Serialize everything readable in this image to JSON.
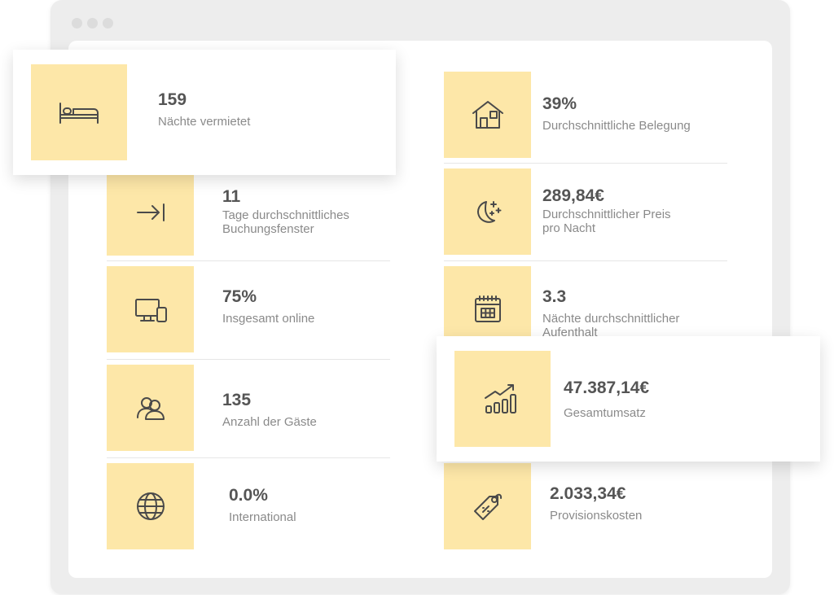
{
  "stats": {
    "naechte": {
      "value": "159",
      "label": "Nächte vermietet",
      "icon": "bed-icon"
    },
    "buchungsfenster": {
      "value": "11",
      "label": "Tage durchschnittliches Buchungsfenster",
      "icon": "arrow-to-bar-icon"
    },
    "online": {
      "value": "75%",
      "label": "Insgesamt online",
      "icon": "devices-icon"
    },
    "gaeste": {
      "value": "135",
      "label": "Anzahl der Gäste",
      "icon": "users-icon"
    },
    "international": {
      "value": "0.0%",
      "label": "International",
      "icon": "globe-icon"
    },
    "belegung": {
      "value": "39%",
      "label": "Durchschnittliche Belegung",
      "icon": "house-icon"
    },
    "preis": {
      "value": "289,84€",
      "label": "Durchschnittlicher Preis pro Nacht",
      "icon": "moon-stars-icon"
    },
    "aufenthalt": {
      "value": "3.3",
      "label": "Nächte durchschnittlicher Aufenthalt",
      "icon": "calendar-icon"
    },
    "umsatz": {
      "value": "47.387,14€",
      "label": "Gesamtumsatz",
      "icon": "growth-chart-icon"
    },
    "provision": {
      "value": "2.033,34€",
      "label": "Provisionskosten",
      "icon": "price-tag-icon"
    }
  },
  "colors": {
    "accent": "#fde7a8",
    "value_text": "#555555",
    "label_text": "#8a8a8a"
  }
}
